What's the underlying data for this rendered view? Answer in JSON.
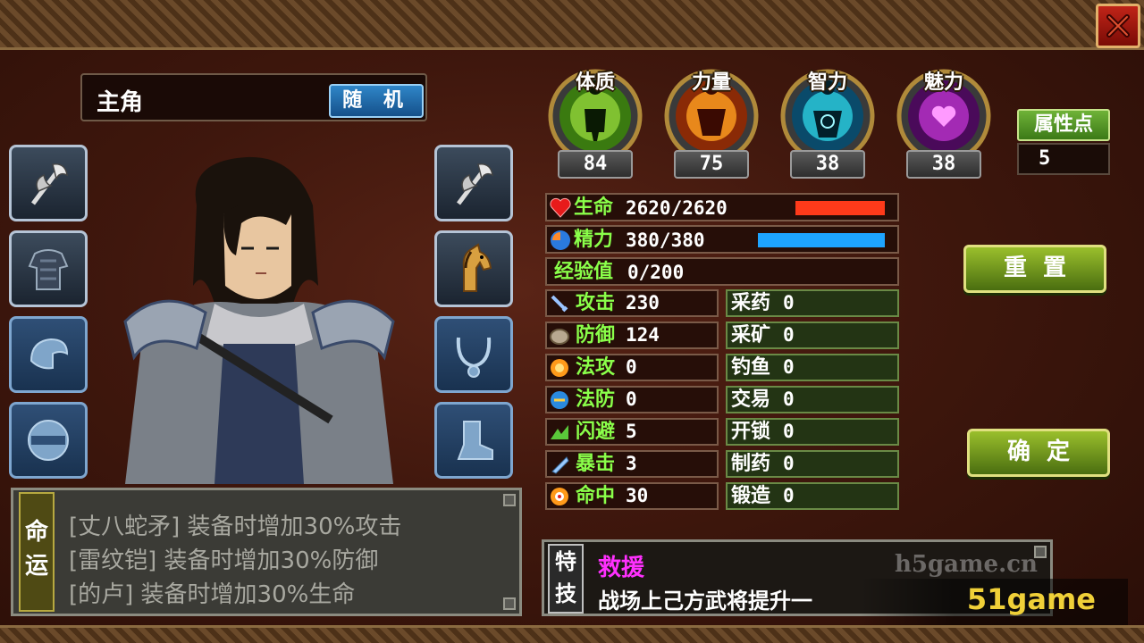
{
  "header": {
    "name": "主角",
    "random_label": "随 机"
  },
  "stats": [
    {
      "label": "体质",
      "value": "84",
      "color": "#7fd12a"
    },
    {
      "label": "力量",
      "value": "75",
      "color": "#ff8a1c"
    },
    {
      "label": "智力",
      "value": "38",
      "color": "#2ad4e8"
    },
    {
      "label": "魅力",
      "value": "38",
      "color": "#d43ae8"
    }
  ],
  "attribute_points": {
    "label": "属性点",
    "value": "5"
  },
  "bars": {
    "hp": {
      "label": "生命",
      "value": "2620/2620",
      "fill": 1.0,
      "color": "#ff3a1a"
    },
    "mp": {
      "label": "精力",
      "value": "380/380",
      "fill": 1.0,
      "color": "#1ea4ff"
    },
    "exp": {
      "label": "经验值",
      "value": "0/200"
    }
  },
  "combat_stats": [
    {
      "label": "攻击",
      "value": "230"
    },
    {
      "label": "防御",
      "value": "124"
    },
    {
      "label": "法攻",
      "value": "0"
    },
    {
      "label": "法防",
      "value": "0"
    },
    {
      "label": "闪避",
      "value": "5"
    },
    {
      "label": "暴击",
      "value": "3"
    },
    {
      "label": "命中",
      "value": "30"
    }
  ],
  "life_skills": [
    {
      "label": "采药",
      "value": "0"
    },
    {
      "label": "采矿",
      "value": "0"
    },
    {
      "label": "钓鱼",
      "value": "0"
    },
    {
      "label": "交易",
      "value": "0"
    },
    {
      "label": "开锁",
      "value": "0"
    },
    {
      "label": "制药",
      "value": "0"
    },
    {
      "label": "锻造",
      "value": "0"
    }
  ],
  "buttons": {
    "reset": "重置",
    "confirm": "确定"
  },
  "fate": {
    "label_1": "命",
    "label_2": "运",
    "lines": [
      "[丈八蛇矛] 装备时增加30%攻击",
      "[雷纹铠] 装备时增加30%防御",
      "[的卢] 装备时增加30%生命"
    ]
  },
  "special_skill": {
    "label_1": "特",
    "label_2": "技",
    "name": "救援",
    "description": "战场上己方武将提升一",
    "ghost_text": "h5game.cn"
  },
  "watermark": "51game"
}
